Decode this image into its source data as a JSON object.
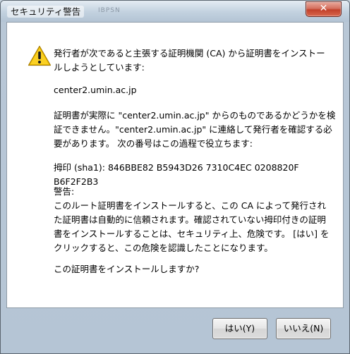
{
  "window": {
    "title": "セキュリティ警告",
    "ghost_title": "IBPSN",
    "close_label": "✕"
  },
  "icon": {
    "name": "warning-icon",
    "color": "#f2c200"
  },
  "message": {
    "p1": "発行者が次であると主張する証明機関 (CA) から証明書をインストー\nルしようとしています:",
    "p2": "center2.umin.ac.jp",
    "p3": "証明書が実際に \"center2.umin.ac.jp\" からのものであるかどうかを検\n証できません。\"center2.umin.ac.jp\" に連絡して発行者を確認する必\n要があります。 次の番号はこの過程で役立ちます:",
    "p4": "拇印 (sha1): 846BBE82 B5943D26 7310C4EC 0208820F B6F2F2B3",
    "p5": "警告:\nこのルート証明書をインストールすると、この CA によって発行され\nた証明書は自動的に信頼されます。確認されていない拇印付きの証明\n書をインストールすることは、セキュリティ上、危険です。 [はい] を\nクリックすると、この危険を認識したことになります。",
    "p6": "この証明書をインストールしますか?"
  },
  "buttons": {
    "yes": "はい(Y)",
    "no": "いいえ(N)"
  }
}
